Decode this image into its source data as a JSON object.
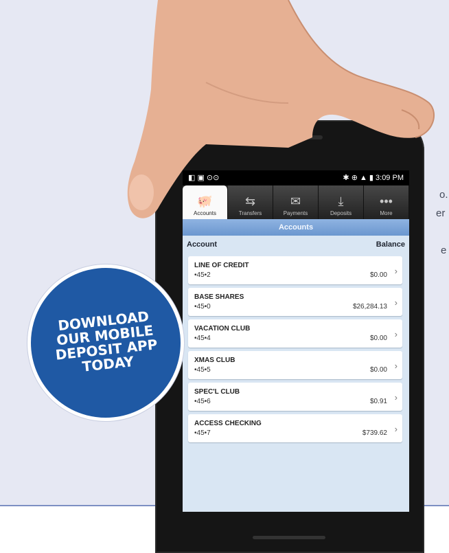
{
  "background_text": {
    "line1": "o.",
    "line2": "er",
    "line3": "e"
  },
  "badge": {
    "lines": [
      "DOWNLOAD",
      "OUR MOBILE",
      "DEPOSIT APP",
      "TODAY"
    ]
  },
  "status_bar": {
    "left": "◧ ▣ ⊙⊙",
    "right": "✱ ⊕ ▲ ▮ 3:09 PM"
  },
  "tabs": [
    {
      "label": "Accounts",
      "icon": "piggy-bank-icon",
      "glyph": "🐖",
      "active": true
    },
    {
      "label": "Transfers",
      "icon": "transfer-arrows-icon",
      "glyph": "⇆",
      "active": false
    },
    {
      "label": "Payments",
      "icon": "envelope-icon",
      "glyph": "✉",
      "active": false
    },
    {
      "label": "Deposits",
      "icon": "deposit-icon",
      "glyph": "⤓",
      "active": false
    },
    {
      "label": "More",
      "icon": "more-dots-icon",
      "glyph": "•••",
      "active": false
    }
  ],
  "page_title": "Accounts",
  "table": {
    "col_account": "Account",
    "col_balance": "Balance"
  },
  "accounts": [
    {
      "name": "LINE OF CREDIT",
      "number": "•45•2",
      "balance": "$0.00"
    },
    {
      "name": "BASE SHARES",
      "number": "•45•0",
      "balance": "$26,284.13"
    },
    {
      "name": "VACATION CLUB",
      "number": "•45•4",
      "balance": "$0.00"
    },
    {
      "name": "XMAS CLUB",
      "number": "•45•5",
      "balance": "$0.00"
    },
    {
      "name": "SPEC'L CLUB",
      "number": "•45•6",
      "balance": "$0.91"
    },
    {
      "name": "ACCESS CHECKING",
      "number": "•45•7",
      "balance": "$739.62"
    }
  ],
  "colors": {
    "badge_blue": "#1f59a4",
    "background": "#e6e8f3",
    "header_blue": "#7ea5d8"
  }
}
